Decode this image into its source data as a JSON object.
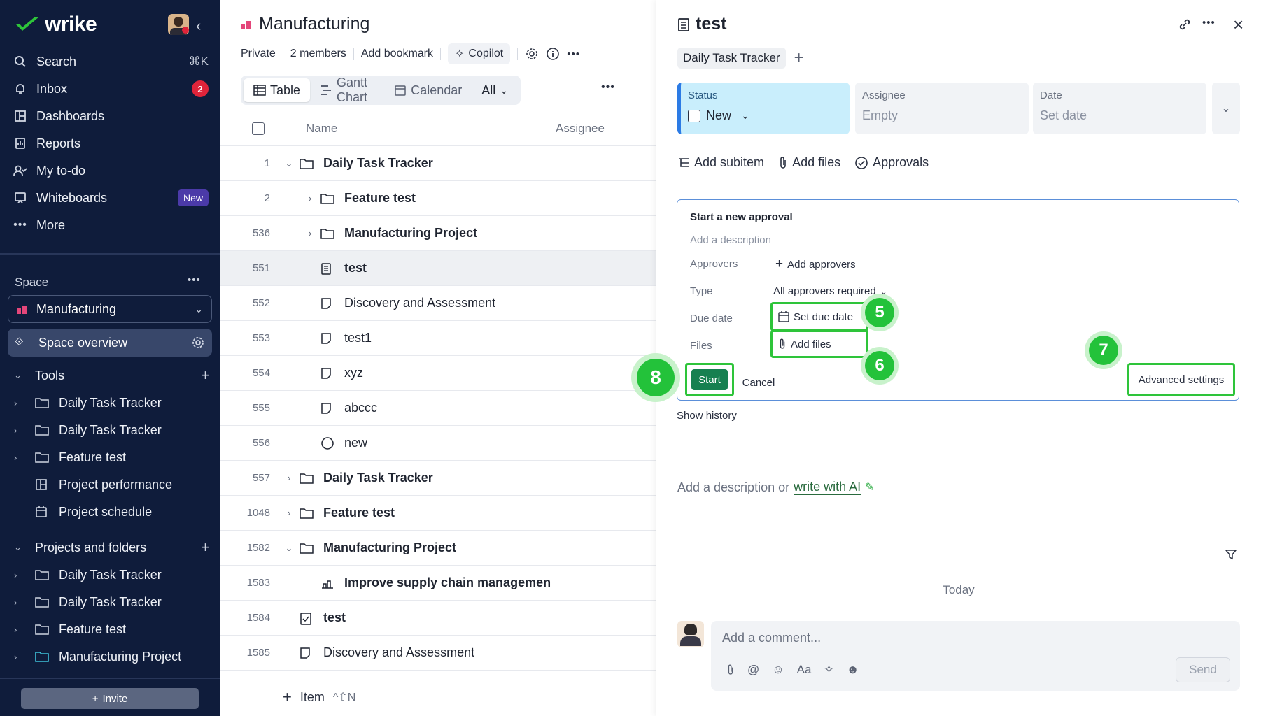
{
  "sidebar": {
    "brand": "wrike",
    "nav": [
      {
        "label": "Search",
        "shortcut": "⌘K",
        "icon": "search-icon"
      },
      {
        "label": "Inbox",
        "badge": "2",
        "icon": "bell-icon"
      },
      {
        "label": "Dashboards",
        "icon": "dashboard-icon"
      },
      {
        "label": "Reports",
        "icon": "reports-icon"
      },
      {
        "label": "My to-do",
        "icon": "user-todo-icon"
      },
      {
        "label": "Whiteboards",
        "badge": "New",
        "icon": "whiteboard-icon"
      },
      {
        "label": "More",
        "icon": "more-icon"
      }
    ],
    "space_label": "Space",
    "space_selected": "Manufacturing",
    "space_overview": "Space overview",
    "tools_label": "Tools",
    "tools": [
      "Daily Task Tracker",
      "Daily Task Tracker",
      "Feature test",
      "Project performance",
      "Project schedule"
    ],
    "projects_label": "Projects and folders",
    "projects": [
      "Daily Task Tracker",
      "Daily Task Tracker",
      "Feature test",
      "Manufacturing Project"
    ],
    "invite_label": "Invite"
  },
  "list": {
    "title": "Manufacturing",
    "meta": {
      "privacy": "Private",
      "members": "2 members",
      "bookmark": "Add bookmark",
      "copilot": "Copilot"
    },
    "tabs": {
      "table": "Table",
      "gantt": "Gantt Chart",
      "calendar": "Calendar",
      "all": "All"
    },
    "columns": {
      "name": "Name",
      "assignee": "Assignee"
    },
    "rows": [
      {
        "num": "1",
        "name": "Daily Task Tracker"
      },
      {
        "num": "2",
        "name": "Feature test"
      },
      {
        "num": "536",
        "name": "Manufacturing Project"
      },
      {
        "num": "551",
        "name": "test"
      },
      {
        "num": "552",
        "name": "Discovery and Assessment"
      },
      {
        "num": "553",
        "name": "test1"
      },
      {
        "num": "554",
        "name": "xyz"
      },
      {
        "num": "555",
        "name": "abccc"
      },
      {
        "num": "556",
        "name": "new"
      },
      {
        "num": "557",
        "name": "Daily Task Tracker"
      },
      {
        "num": "1048",
        "name": "Feature test"
      },
      {
        "num": "1582",
        "name": "Manufacturing Project"
      },
      {
        "num": "1583",
        "name": "Improve supply chain managemen"
      },
      {
        "num": "1584",
        "name": "test"
      },
      {
        "num": "1585",
        "name": "Discovery and Assessment"
      }
    ],
    "add_item": "Item",
    "add_item_shortcut": "^⇧N"
  },
  "detail": {
    "title": "test",
    "tracker_chip": "Daily Task Tracker",
    "fields": {
      "status_label": "Status",
      "status_value": "New",
      "assignee_label": "Assignee",
      "assignee_value": "Empty",
      "date_label": "Date",
      "date_value": "Set date"
    },
    "actions": {
      "subitem": "Add subitem",
      "files": "Add files",
      "approvals": "Approvals"
    },
    "approval": {
      "heading": "Start a new approval",
      "description_placeholder": "Add a description",
      "approvers_label": "Approvers",
      "approvers_value": "Add approvers",
      "type_label": "Type",
      "type_value": "All approvers required",
      "due_label": "Due date",
      "due_value": "Set due date",
      "files_label": "Files",
      "files_value": "Add files",
      "start": "Start",
      "cancel": "Cancel",
      "advanced": "Advanced settings"
    },
    "steps": {
      "s5": "5",
      "s6": "6",
      "s7": "7",
      "s8": "8"
    },
    "show_history": "Show history",
    "desc_prefix": "Add a description or",
    "desc_ai": "write with AI",
    "today": "Today",
    "comment_placeholder": "Add a comment...",
    "send": "Send"
  },
  "colors": {
    "sidebar_bg": "#0f1c3b",
    "status_bg": "#c9eefc",
    "accent_green": "#23c23a",
    "start_green": "#168050"
  }
}
